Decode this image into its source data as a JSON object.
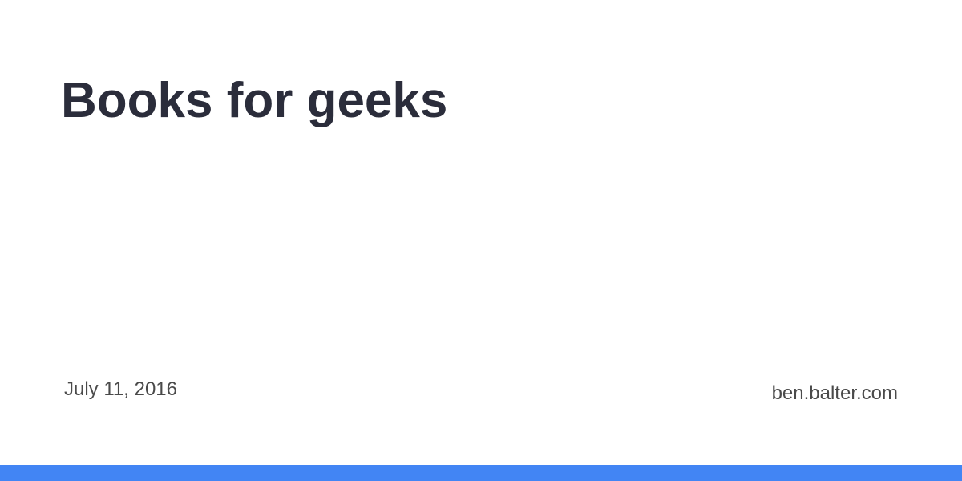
{
  "post": {
    "title": "Books for geeks",
    "date": "July 11, 2016"
  },
  "site": {
    "domain": "ben.balter.com"
  },
  "colors": {
    "background": "#ffffff",
    "title": "#2b2d3b",
    "meta_text": "#4a4a4a",
    "accent": "#4285f4"
  }
}
